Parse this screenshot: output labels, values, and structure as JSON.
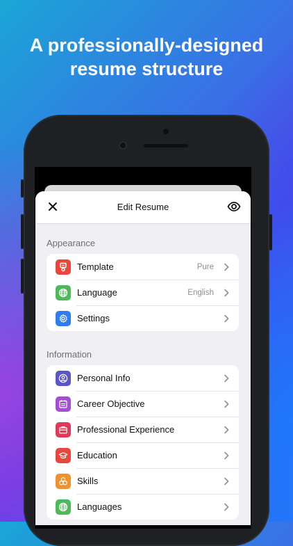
{
  "headline": {
    "line1": "A professionally-designed",
    "line2": "resume structure"
  },
  "nav": {
    "title": "Edit Resume"
  },
  "appearance": {
    "label": "Appearance",
    "items": [
      {
        "label": "Template",
        "value": "Pure",
        "icon": "template-icon",
        "color": "#e8473e"
      },
      {
        "label": "Language",
        "value": "English",
        "icon": "globe-icon",
        "color": "#4fb85a"
      },
      {
        "label": "Settings",
        "value": "",
        "icon": "gear-icon",
        "color": "#2f7bf0"
      }
    ]
  },
  "information": {
    "label": "Information",
    "items": [
      {
        "label": "Personal Info",
        "icon": "user-icon",
        "color": "#5a55c8"
      },
      {
        "label": "Career Objective",
        "icon": "calendar-icon",
        "color": "#a34fcf"
      },
      {
        "label": "Professional Experience",
        "icon": "briefcase-icon",
        "color": "#e0395b"
      },
      {
        "label": "Education",
        "icon": "graduation-cap-icon",
        "color": "#e8473e"
      },
      {
        "label": "Skills",
        "icon": "skills-icon",
        "color": "#f0932e"
      },
      {
        "label": "Languages",
        "icon": "globe-icon",
        "color": "#4fb85a"
      }
    ]
  }
}
